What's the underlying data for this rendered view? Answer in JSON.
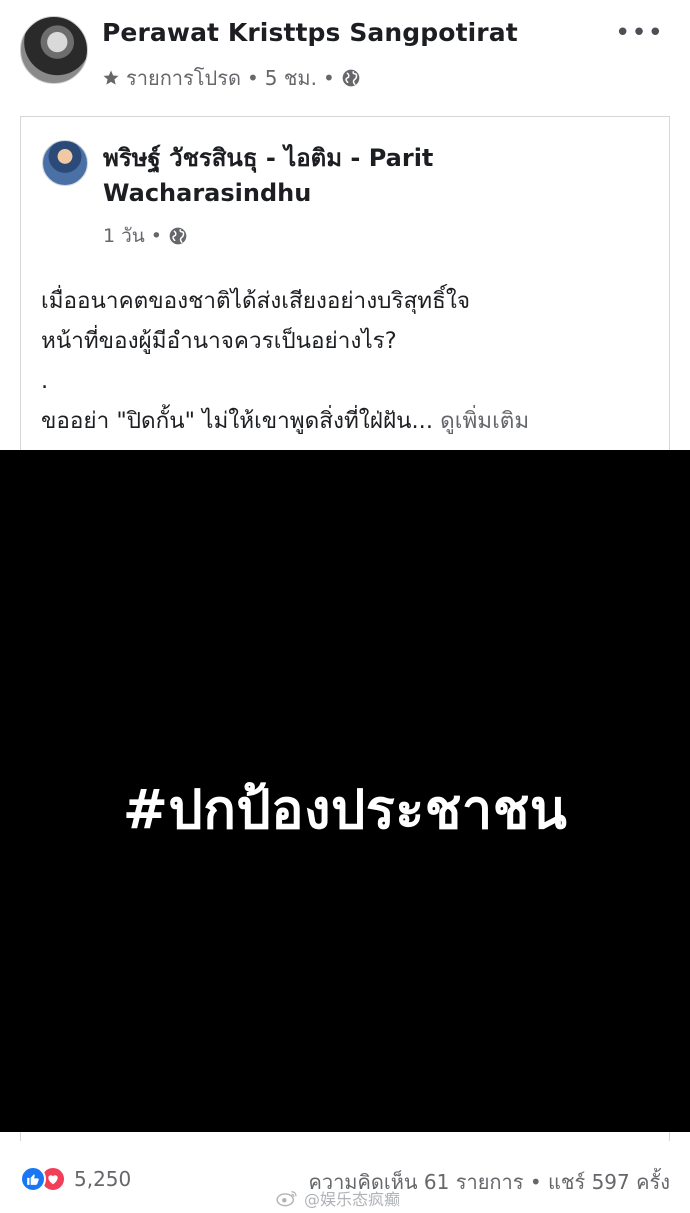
{
  "post": {
    "author": "Perawat Kristtps Sangpotirat",
    "favorites_label": "รายการโปรด",
    "time": "5 ชม.",
    "more_label": "•••",
    "dot": "•"
  },
  "shared_post": {
    "author": "พริษฐ์ วัชรสินธุ - ไอติม - Parit Wacharasindhu",
    "time": "1 วัน",
    "text": {
      "line1": "เมื่ออนาคตของชาติได้ส่งเสียงอย่างบริสุทธิ์ใจ",
      "line2": "หน้าที่ของผู้มีอำนาจควรเป็นอย่างไร?",
      "line3": ".",
      "line4": "ขออย่า \"ปิดกั้น\" ไม่ให้เขาพูดสิ่งที่ใฝ่ฝัน...",
      "see_more": "ดูเพิ่มเติม"
    }
  },
  "media": {
    "hashtag": "#ปกป้องประชาชน",
    "background": "#000000"
  },
  "footer": {
    "reaction_count": "5,250",
    "comments": "ความคิดเห็น 61 รายการ",
    "shares": "แชร์ 597 ครั้ง",
    "dot": "•"
  },
  "watermark": {
    "text": "@娱乐态疯癫"
  },
  "colors": {
    "like": "#1877f2",
    "love": "#f33e58",
    "secondary_text": "#65676b"
  },
  "icons": [
    "star-icon",
    "globe-icon",
    "like-reaction-icon",
    "love-reaction-icon",
    "weibo-logo-icon"
  ]
}
